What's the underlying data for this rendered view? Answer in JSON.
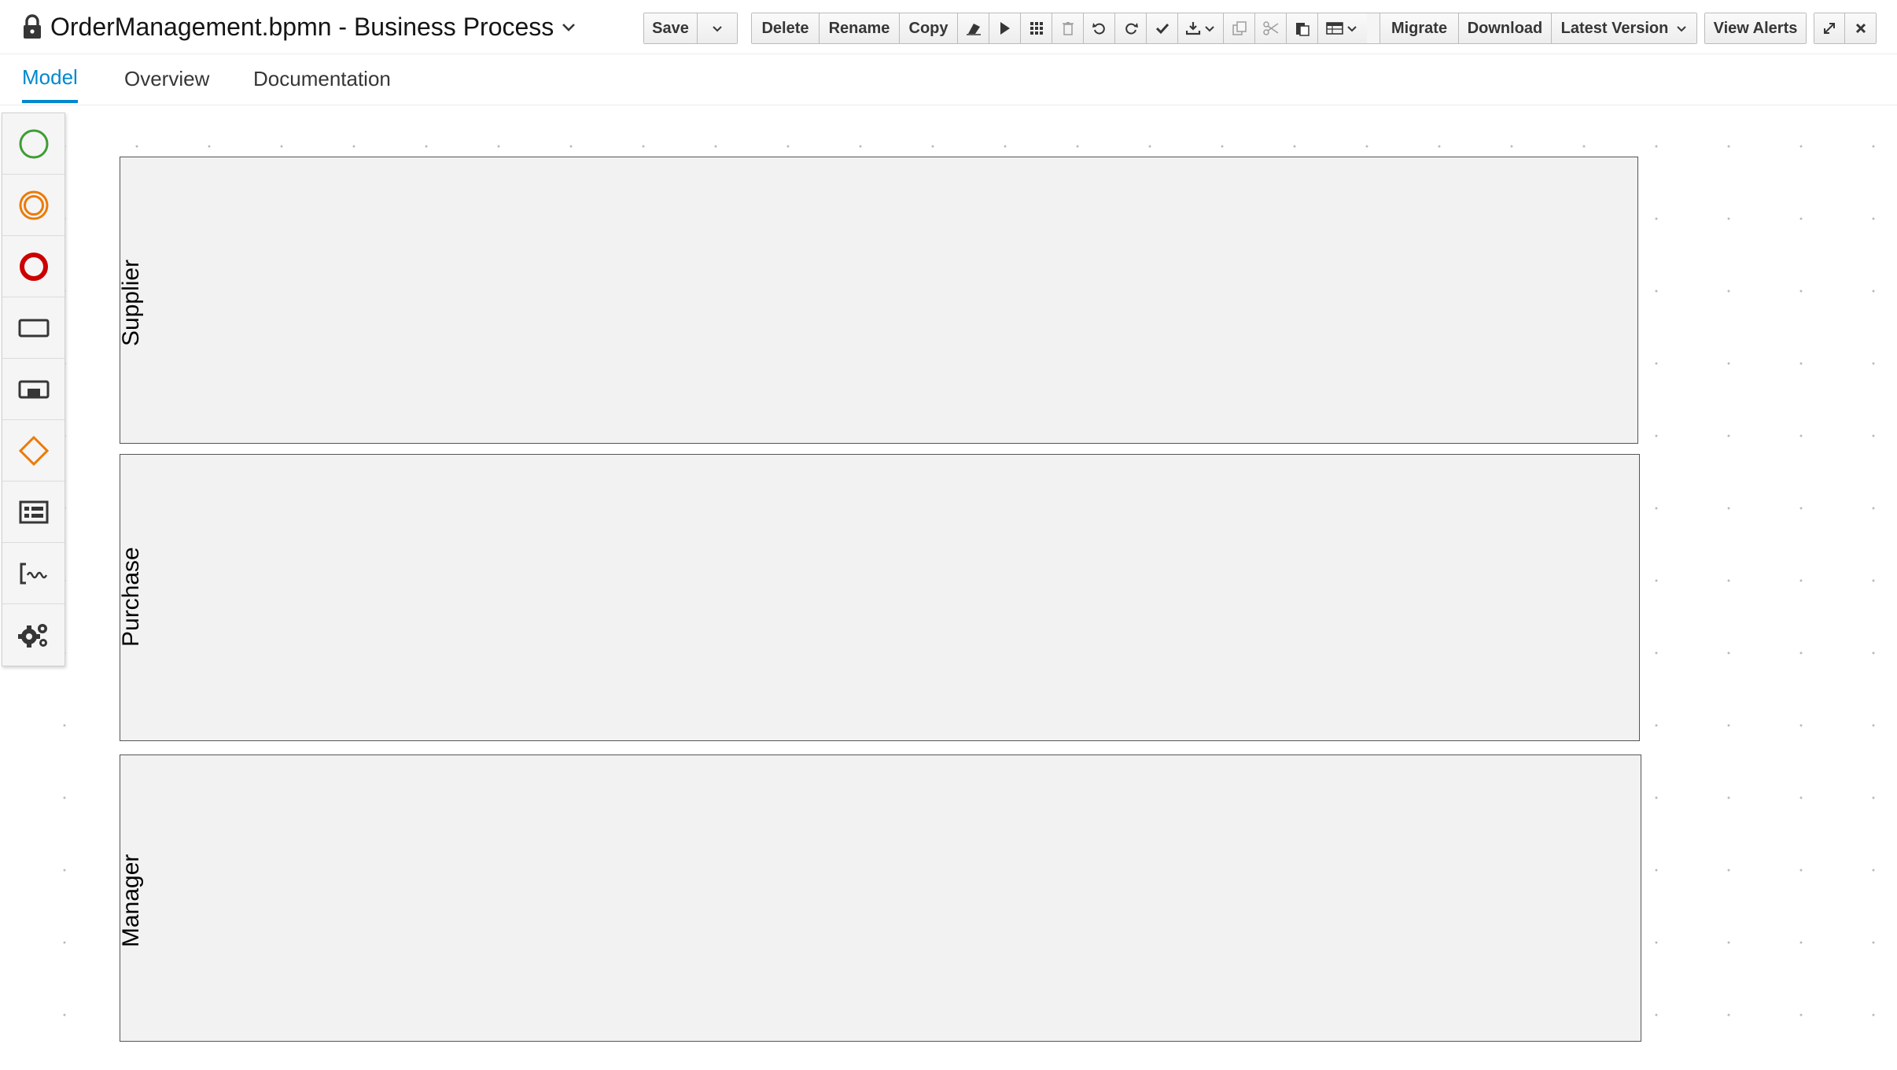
{
  "header": {
    "title": "OrderManagement.bpmn - Business Process"
  },
  "toolbar": {
    "save_label": "Save",
    "delete_label": "Delete",
    "rename_label": "Rename",
    "copy_label": "Copy",
    "migrate_label": "Migrate",
    "download_label": "Download",
    "version_label": "Latest Version",
    "alerts_label": "View Alerts"
  },
  "tabs": [
    {
      "label": "Model"
    },
    {
      "label": "Overview"
    },
    {
      "label": "Documentation"
    }
  ],
  "palette": {
    "items": [
      {
        "icon": "start-event-icon",
        "color": "#3f9c35"
      },
      {
        "icon": "intermediate-event-icon",
        "color": "#ec7a08"
      },
      {
        "icon": "end-event-icon",
        "color": "#cc0000"
      },
      {
        "icon": "task-icon"
      },
      {
        "icon": "subprocess-icon"
      },
      {
        "icon": "gateway-icon",
        "color": "#ec7a08"
      },
      {
        "icon": "container-icon"
      },
      {
        "icon": "artifact-icon"
      },
      {
        "icon": "custom-tasks-icon"
      }
    ]
  },
  "lanes": [
    {
      "label": "Supplier"
    },
    {
      "label": "Purchase"
    },
    {
      "label": "Manager"
    }
  ],
  "colors": {
    "accent": "#0088ce",
    "lane_fill": "#f2f2f2",
    "lane_border": "#555555"
  }
}
